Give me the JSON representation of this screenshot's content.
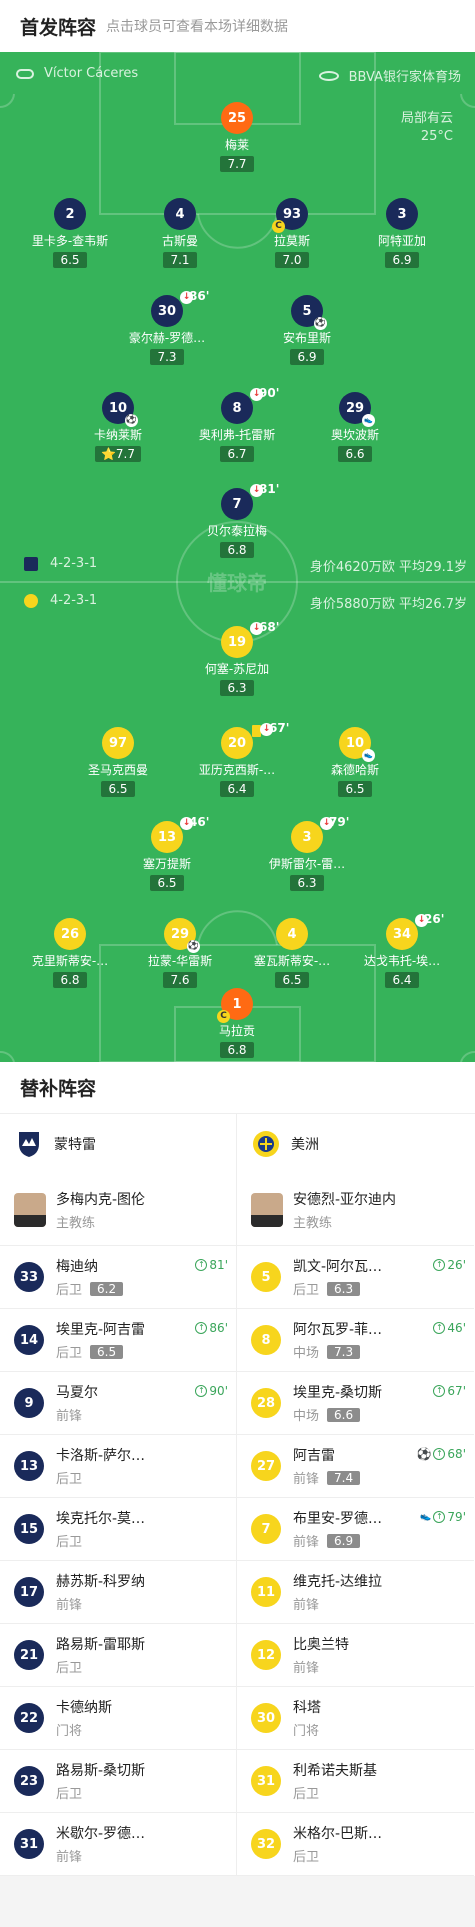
{
  "header": {
    "title": "首发阵容",
    "subtitle": "点击球员可查看本场详细数据"
  },
  "pitch": {
    "referee": "Víctor Cáceres",
    "stadium": "BBVA银行家体育场",
    "weather": "局部有云",
    "temperature": "25°C",
    "watermark": "懂球帝",
    "home_formation": "4-2-3-1",
    "home_value": "身价4620万欧 平均29.1岁",
    "away_formation": "4-2-3-1",
    "away_value": "身价5880万欧 平均26.7岁"
  },
  "home_players": [
    {
      "num": "25",
      "name": "梅莱",
      "rating": "7.7",
      "gk": true
    },
    {
      "num": "2",
      "name": "里卡多-查韦斯",
      "rating": "6.5"
    },
    {
      "num": "4",
      "name": "古斯曼",
      "rating": "7.1"
    },
    {
      "num": "93",
      "name": "拉莫斯",
      "rating": "7.0",
      "captain": true
    },
    {
      "num": "3",
      "name": "阿特亚加",
      "rating": "6.9"
    },
    {
      "num": "30",
      "name": "豪尔赫-罗德…",
      "rating": "7.3",
      "sub_out": "86'"
    },
    {
      "num": "5",
      "name": "安布里斯",
      "rating": "6.9",
      "goal": true
    },
    {
      "num": "10",
      "name": "卡纳莱斯",
      "rating": "7.7",
      "goal": true,
      "star": true
    },
    {
      "num": "8",
      "name": "奥利弗-托雷斯",
      "rating": "6.7",
      "sub_out": "90'"
    },
    {
      "num": "29",
      "name": "奥坎波斯",
      "rating": "6.6",
      "assist": true
    },
    {
      "num": "7",
      "name": "贝尔泰拉梅",
      "rating": "6.8",
      "sub_out": "81'"
    }
  ],
  "away_players": [
    {
      "num": "19",
      "name": "何塞-苏尼加",
      "rating": "6.3",
      "sub_out": "68'"
    },
    {
      "num": "97",
      "name": "圣马克西曼",
      "rating": "6.5"
    },
    {
      "num": "20",
      "name": "亚历克西斯-…",
      "rating": "6.4",
      "yellow": true,
      "sub_out": "67'"
    },
    {
      "num": "10",
      "name": "森德哈斯",
      "rating": "6.5",
      "assist": true
    },
    {
      "num": "13",
      "name": "塞万提斯",
      "rating": "6.5",
      "sub_out": "46'"
    },
    {
      "num": "3",
      "name": "伊斯雷尔-雷…",
      "rating": "6.3",
      "sub_out": "79'"
    },
    {
      "num": "26",
      "name": "克里斯蒂安-…",
      "rating": "6.8"
    },
    {
      "num": "29",
      "name": "拉蒙-华雷斯",
      "rating": "7.6",
      "goal": true
    },
    {
      "num": "4",
      "name": "塞瓦斯蒂安-…",
      "rating": "6.5"
    },
    {
      "num": "34",
      "name": "达戈韦托-埃…",
      "rating": "6.4",
      "sub_out": "26'"
    },
    {
      "num": "1",
      "name": "马拉贡",
      "rating": "6.8",
      "gk": true,
      "captain": true
    }
  ],
  "bench": {
    "title": "替补阵容",
    "home": {
      "team": "蒙特雷",
      "coach": "多梅内克-图伦",
      "coach_role": "主教练",
      "players": [
        {
          "num": "33",
          "name": "梅迪纳",
          "pos": "后卫",
          "rating": "6.2",
          "sub_in": "81'"
        },
        {
          "num": "14",
          "name": "埃里克-阿吉雷",
          "pos": "后卫",
          "rating": "6.5",
          "sub_in": "86'"
        },
        {
          "num": "9",
          "name": "马夏尔",
          "pos": "前锋",
          "sub_in": "90'"
        },
        {
          "num": "13",
          "name": "卡洛斯-萨尔…",
          "pos": "后卫"
        },
        {
          "num": "15",
          "name": "埃克托尔-莫…",
          "pos": "后卫"
        },
        {
          "num": "17",
          "name": "赫苏斯-科罗纳",
          "pos": "前锋"
        },
        {
          "num": "21",
          "name": "路易斯-雷耶斯",
          "pos": "后卫"
        },
        {
          "num": "22",
          "name": "卡德纳斯",
          "pos": "门将"
        },
        {
          "num": "23",
          "name": "路易斯-桑切斯",
          "pos": "后卫"
        },
        {
          "num": "31",
          "name": "米歇尔-罗德…",
          "pos": "前锋"
        }
      ]
    },
    "away": {
      "team": "美洲",
      "coach": "安德烈-亚尔迪内",
      "coach_role": "主教练",
      "players": [
        {
          "num": "5",
          "name": "凯文-阿尔瓦…",
          "pos": "后卫",
          "rating": "6.3",
          "sub_in": "26'"
        },
        {
          "num": "8",
          "name": "阿尔瓦罗-菲…",
          "pos": "中场",
          "rating": "7.3",
          "sub_in": "46'"
        },
        {
          "num": "28",
          "name": "埃里克-桑切斯",
          "pos": "中场",
          "rating": "6.6",
          "sub_in": "67'"
        },
        {
          "num": "27",
          "name": "阿吉雷",
          "pos": "前锋",
          "rating": "7.4",
          "sub_in": "68'",
          "goal": true
        },
        {
          "num": "7",
          "name": "布里安-罗德…",
          "pos": "前锋",
          "rating": "6.9",
          "sub_in": "79'",
          "assist": true
        },
        {
          "num": "11",
          "name": "维克托-达维拉",
          "pos": "前锋"
        },
        {
          "num": "12",
          "name": "比奥兰特",
          "pos": "前锋"
        },
        {
          "num": "30",
          "name": "科塔",
          "pos": "门将"
        },
        {
          "num": "31",
          "name": "利希诺夫斯基",
          "pos": "后卫"
        },
        {
          "num": "32",
          "name": "米格尔-巴斯…",
          "pos": "后卫"
        }
      ]
    }
  },
  "colors": {
    "pitch": "#36b35a",
    "home": "#1a2a5a",
    "away": "#f7d51d",
    "gk": "#ff6a13"
  }
}
